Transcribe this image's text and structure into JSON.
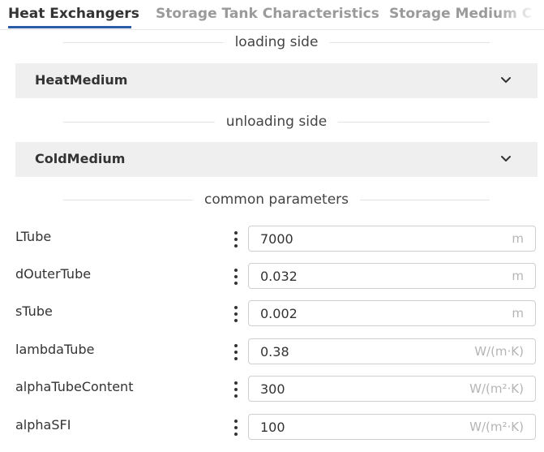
{
  "tabs": [
    {
      "label": "Heat Exchangers",
      "active": true
    },
    {
      "label": "Storage Tank Characteristics",
      "active": false
    },
    {
      "label": "Storage Medium C",
      "active": false
    }
  ],
  "sections": {
    "loading": "loading side",
    "unloading": "unloading side",
    "common": "common parameters"
  },
  "groups": {
    "heat": "HeatMedium",
    "cold": "ColdMedium"
  },
  "params": [
    {
      "name": "LTube",
      "value": "7000",
      "unit": "m"
    },
    {
      "name": "dOuterTube",
      "value": "0.032",
      "unit": "m"
    },
    {
      "name": "sTube",
      "value": "0.002",
      "unit": "m"
    },
    {
      "name": "lambdaTube",
      "value": "0.38",
      "unit": "W/(m·K)"
    },
    {
      "name": "alphaTubeContent",
      "value": "300",
      "unit": "W/(m²·K)"
    },
    {
      "name": "alphaSFI",
      "value": "100",
      "unit": "W/(m²·K)"
    }
  ],
  "colors": {
    "accent": "#2c5ba8",
    "group_bg": "#efefef"
  },
  "icons": {
    "group_toggle": "chevron-down-icon",
    "param_menu": "vertical-dots-icon"
  }
}
